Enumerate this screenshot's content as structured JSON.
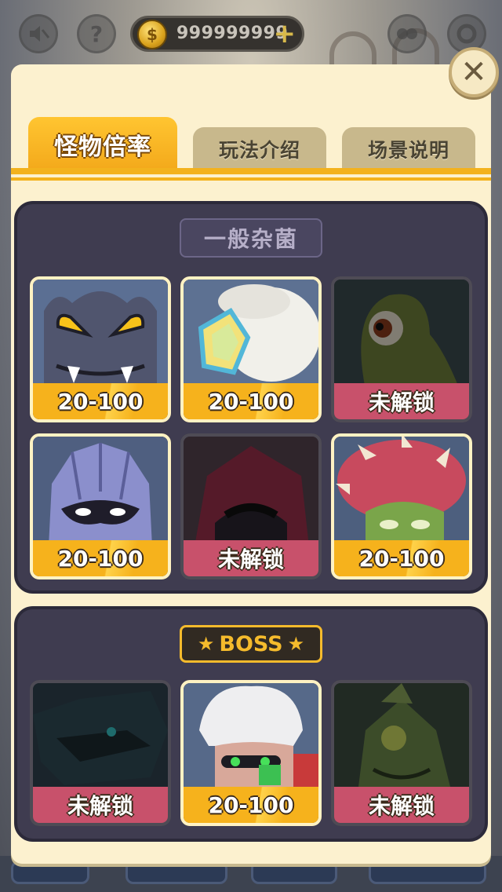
{
  "hud": {
    "sound_icon": "muted-speaker-icon",
    "help_icon": "question-icon",
    "help_glyph": "?",
    "coins": "999999999",
    "coin_glyph": "$",
    "add_glyph": "+",
    "right_icons": [
      "gamepad-icon",
      "settings-icon"
    ]
  },
  "panel": {
    "close_glyph": "✕",
    "tabs": [
      {
        "label": "怪物倍率",
        "active": true
      },
      {
        "label": "玩法介绍",
        "active": false
      },
      {
        "label": "场景说明",
        "active": false
      }
    ]
  },
  "normal_section": {
    "title": "一般杂菌",
    "cards": [
      {
        "monster": "gray-horned-beast",
        "label": "20-100",
        "locked": false
      },
      {
        "monster": "white-feather-crystal",
        "label": "20-100",
        "locked": false
      },
      {
        "monster": "green-cyclops",
        "label": "未解锁",
        "locked": true
      },
      {
        "monster": "lilac-masked-ghost",
        "label": "20-100",
        "locked": false
      },
      {
        "monster": "crimson-hooded-rogue",
        "label": "未解锁",
        "locked": true
      },
      {
        "monster": "spiked-mushroom-zombie",
        "label": "20-100",
        "locked": false
      }
    ]
  },
  "boss_section": {
    "title": "BOSS",
    "star_glyph": "★",
    "cards": [
      {
        "monster": "shark-dragon",
        "label": "未解锁",
        "locked": true
      },
      {
        "monster": "white-haired-cyborg",
        "label": "20-100",
        "locked": false
      },
      {
        "monster": "green-lizard-dragon",
        "label": "未解锁",
        "locked": true
      }
    ]
  },
  "colors": {
    "panel_bg": "#fcf1cf",
    "tab_active": "#f3a81a",
    "section_bg": "#3f3c50",
    "unlocked_label": "#f6b21c",
    "locked_label": "#c8516b",
    "boss_accent": "#f5bb2c"
  }
}
